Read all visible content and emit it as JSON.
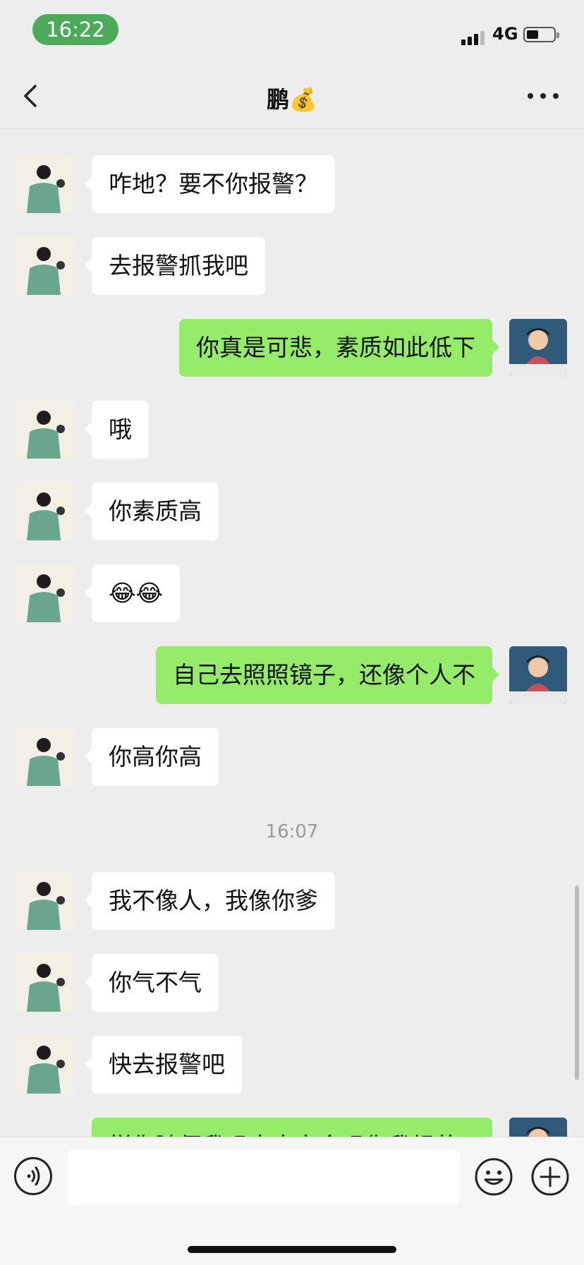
{
  "status": {
    "time": "16:22",
    "network": "4G"
  },
  "nav": {
    "title": "鹏💰"
  },
  "messages": [
    {
      "from": "them",
      "text": "咋地？要不你报警？"
    },
    {
      "from": "them",
      "text": "去报警抓我吧"
    },
    {
      "from": "me",
      "text": "你真是可悲，素质如此低下"
    },
    {
      "from": "them",
      "text": "哦"
    },
    {
      "from": "them",
      "text": "你素质高"
    },
    {
      "from": "them",
      "text": "😂😂"
    },
    {
      "from": "me",
      "text": "自己去照照镜子，还像个人不"
    },
    {
      "from": "them",
      "text": "你高你高"
    },
    {
      "from": "time",
      "text": "16:07"
    },
    {
      "from": "them",
      "text": "我不像人，我像你爹"
    },
    {
      "from": "them",
      "text": "你气不气"
    },
    {
      "from": "them",
      "text": "快去报警吧"
    },
    {
      "from": "me",
      "text": "样你随便我吗古古安全吗你我规范"
    }
  ],
  "input": {
    "value": "",
    "placeholder": ""
  },
  "colors": {
    "outgoing": "#95ec69",
    "incoming": "#ffffff",
    "background": "#ededed",
    "time_pill": "#4caa5a"
  }
}
